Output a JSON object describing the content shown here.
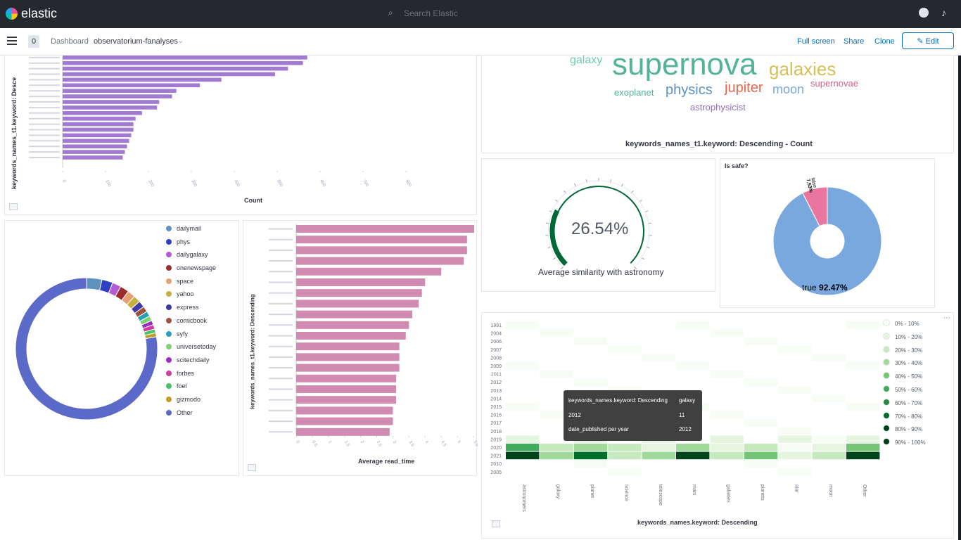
{
  "app": {
    "brand": "elastic",
    "search_placeholder": "Search Elastic"
  },
  "header": {
    "spaces_badge": "0",
    "breadcrumb": [
      "Dashboard",
      "observatorium-fanalyses"
    ],
    "actions": {
      "full_screen": "Full screen",
      "share": "Share",
      "clone": "Clone",
      "edit": "Edit"
    }
  },
  "icons": [
    "elastic-logo-icon",
    "search-icon",
    "help-icon",
    "notification-icon",
    "hamburger-menu-icon",
    "chevron-down-icon",
    "pencil-icon",
    "panel-menu-icon",
    "more-options-icon"
  ],
  "colors": {
    "topbar": "#25282f",
    "accent": "#006bb4",
    "bars_keywords": "#a37ad1",
    "bars_readtime": "#d18bb0",
    "gauge": "#006837",
    "pie_true": "#78a8de",
    "pie_false": "#e8769f"
  },
  "panel_keywords": {
    "ylabel": "keywords_names_t1.keyword: Desce",
    "xlabel": "Count"
  },
  "panel_wordcloud": {
    "caption": "keywords_names_t1.keyword: Descending - Count",
    "words": [
      {
        "text": "supernova",
        "color": "#54b399"
      },
      {
        "text": "galaxies",
        "color": "#d6bf57"
      },
      {
        "text": "galaxy",
        "color": "#6dccb1"
      },
      {
        "text": "physics",
        "color": "#6092c0"
      },
      {
        "text": "jupiter",
        "color": "#e7664c"
      },
      {
        "text": "moon",
        "color": "#79aad9"
      },
      {
        "text": "supernovae",
        "color": "#d36086"
      },
      {
        "text": "exoplanet",
        "color": "#54b399"
      },
      {
        "text": "astrophysicist",
        "color": "#9170b8"
      }
    ]
  },
  "panel_gauge": {
    "value_text": "26.54%",
    "label": "Average similarity with astronomy",
    "value": 26.54
  },
  "panel_pie": {
    "title": "Is safe?",
    "label_true": "true",
    "value_true": "92.47%",
    "label_false": "false",
    "value_false": "7.53%"
  },
  "panel_donut": {
    "legend": [
      "dailymail",
      "phys",
      "dailygalaxy",
      "onenewspage",
      "space",
      "yahoo",
      "express",
      "comicbook",
      "syfy",
      "universetoday",
      "scitechdaily",
      "forbes",
      "foel",
      "gizmodo",
      "Other"
    ],
    "legend_colors": [
      "#6092c0",
      "#2f3fbf",
      "#b35cd6",
      "#9a2c2c",
      "#e7a074",
      "#c8b040",
      "#3e3aa8",
      "#a0523d",
      "#2aa0b4",
      "#7fd070",
      "#9b2fc0",
      "#d03a9c",
      "#47c466",
      "#bf9b27",
      "#5b6ac9"
    ]
  },
  "panel_readtime": {
    "ylabel": "keywords_names_t1.keyword: Descending",
    "xlabel": "Average read_time"
  },
  "panel_heatmap": {
    "xlabel": "keywords_names.keyword: Descending",
    "x_ticks": [
      "astronomers",
      "galaxy",
      "planet",
      "science",
      "telescope",
      "mars",
      "galaxies",
      "planets",
      "star",
      "moon",
      "Other"
    ],
    "y_ticks": [
      "1991",
      "2004",
      "2006",
      "2007",
      "2008",
      "2009",
      "2011",
      "2012",
      "2013",
      "2014",
      "2015",
      "2016",
      "2017",
      "2018",
      "2019",
      "2020",
      "2021",
      "2010",
      "2005"
    ],
    "legend": [
      "0% - 10%",
      "10% - 20%",
      "20% - 30%",
      "30% - 40%",
      "40% - 50%",
      "50% - 60%",
      "60% - 70%",
      "70% - 80%",
      "80% - 90%",
      "90% - 100%"
    ],
    "legend_colors": [
      "#f7fcf5",
      "#e5f5e0",
      "#c7e9c0",
      "#a1d99b",
      "#74c476",
      "#41ab5d",
      "#238b45",
      "#006d2c",
      "#00441b",
      "#003a16"
    ],
    "tooltip": {
      "row1_key": "keywords_names.keyword: Descending",
      "row1_val": "galaxy",
      "row2_key": "2012",
      "row2_val": "11",
      "row3_key": "date_published per year",
      "row3_val": "2012"
    }
  },
  "chart_data": [
    {
      "type": "bar",
      "orientation": "horizontal",
      "ylabel": "keywords_names_t1.keyword: Desce",
      "xlabel": "Count",
      "values": [
        570,
        560,
        525,
        495,
        370,
        320,
        265,
        255,
        225,
        220,
        185,
        170,
        165,
        165,
        160,
        155,
        150,
        145,
        140
      ],
      "xlim": [
        0,
        800
      ]
    },
    {
      "type": "bar",
      "orientation": "horizontal",
      "ylabel": "keywords_names_t1.keyword: Descending",
      "xlabel": "Average read_time",
      "values": [
        5.9,
        5.3,
        5.3,
        5.2,
        4.5,
        4.0,
        3.9,
        3.8,
        3.6,
        3.5,
        3.4,
        3.2,
        3.2,
        3.2,
        3.1,
        3.1,
        3.1,
        3.0,
        3.0,
        2.9
      ],
      "xlim": [
        0,
        5.5
      ]
    },
    {
      "type": "pie",
      "donut": true,
      "labels": [
        "dailymail",
        "phys",
        "dailygalaxy",
        "onenewspage",
        "space",
        "yahoo",
        "express",
        "comicbook",
        "syfy",
        "universetoday",
        "scitechdaily",
        "forbes",
        "foel",
        "gizmodo",
        "Other"
      ],
      "values": [
        3.5,
        2.5,
        2.0,
        2.0,
        1.8,
        1.6,
        1.5,
        1.3,
        1.2,
        1.1,
        1.0,
        1.0,
        0.9,
        0.9,
        77.7
      ]
    },
    {
      "type": "pie",
      "donut": true,
      "title": "Is safe?",
      "labels": [
        "true",
        "false"
      ],
      "values": [
        92.47,
        7.53
      ]
    },
    {
      "type": "heatmap",
      "xlabel": "keywords_names.keyword: Descending",
      "x": [
        "astronomers",
        "galaxy",
        "planet",
        "science",
        "telescope",
        "mars",
        "galaxies",
        "planets",
        "star",
        "moon",
        "Other"
      ],
      "y": [
        "1991",
        "2004",
        "2006",
        "2007",
        "2008",
        "2009",
        "2011",
        "2012",
        "2013",
        "2014",
        "2015",
        "2016",
        "2017",
        "2018",
        "2019",
        "2020",
        "2021",
        "2010",
        "2005"
      ]
    }
  ]
}
